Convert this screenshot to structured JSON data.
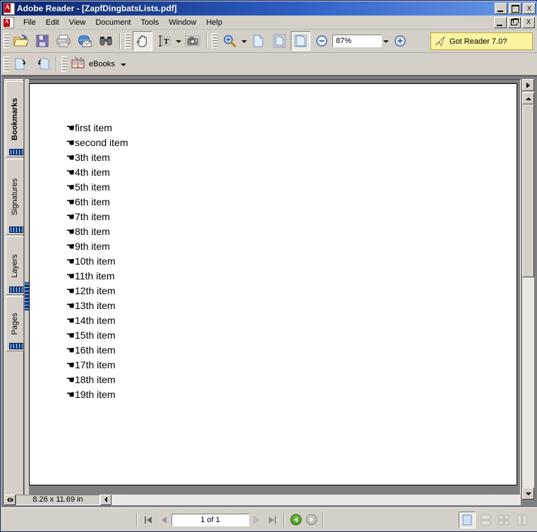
{
  "window": {
    "title": "Adobe Reader - [ZapfDingbatsLists.pdf]",
    "app_icon": "acrobat-icon",
    "controls": {
      "minimize": "_",
      "maximize": "□",
      "restore": "❐",
      "close": "X"
    }
  },
  "menu": {
    "icon": "acrobat-document-icon",
    "items": [
      {
        "label": "File"
      },
      {
        "label": "Edit"
      },
      {
        "label": "View"
      },
      {
        "label": "Document"
      },
      {
        "label": "Tools"
      },
      {
        "label": "Window"
      },
      {
        "label": "Help"
      }
    ]
  },
  "toolbar_main": {
    "groups": [
      {
        "buttons": [
          {
            "name": "open-file-button",
            "icon": "open-folder-icon"
          },
          {
            "name": "save-button",
            "icon": "floppy-disk-icon"
          },
          {
            "name": "print-button",
            "icon": "printer-icon"
          },
          {
            "name": "email-button",
            "icon": "globe-envelope-icon"
          },
          {
            "name": "search-button",
            "icon": "binoculars-icon"
          }
        ]
      },
      {
        "buttons": [
          {
            "name": "hand-tool-button",
            "icon": "hand-icon",
            "active": true
          },
          {
            "name": "select-text-tool-button",
            "icon": "text-select-icon",
            "has_dropdown": true
          },
          {
            "name": "snapshot-tool-button",
            "icon": "camera-icon"
          }
        ]
      },
      {
        "buttons": [
          {
            "name": "zoom-tool-button",
            "icon": "magnifier-plus-icon",
            "has_dropdown": true
          },
          {
            "name": "actual-size-button",
            "icon": "page-actual-size-icon"
          },
          {
            "name": "fit-page-button",
            "icon": "page-fit-icon"
          },
          {
            "name": "fit-width-button",
            "icon": "page-fit-width-icon"
          },
          {
            "name": "zoom-out-button",
            "icon": "circle-minus-icon"
          },
          {
            "name": "zoom-in-button",
            "icon": "circle-plus-icon"
          }
        ]
      }
    ],
    "zoom_value": "87%",
    "zoom_dropdown_icon": "chevron-down-icon"
  },
  "promo": {
    "label": "Got Reader 7.0?",
    "icon": "paper-plane-icon",
    "background": "#fbf3a0",
    "border": "#b9ad3a"
  },
  "toolbar_secondary": {
    "buttons": [
      {
        "name": "previous-view-button",
        "icon": "page-back-arrow-icon"
      },
      {
        "name": "next-view-button",
        "icon": "page-forward-arrow-icon"
      }
    ],
    "ebooks": {
      "label": "eBooks",
      "icon": "ebooks-icon",
      "dropdown_icon": "chevron-down-icon"
    }
  },
  "navigation_pane": {
    "tabs": [
      {
        "label": "Bookmarks",
        "selected": true
      },
      {
        "label": "Signatures",
        "selected": false
      },
      {
        "label": "Layers",
        "selected": false
      },
      {
        "label": "Pages",
        "selected": false
      }
    ]
  },
  "document": {
    "page_size": "8.26 x 11.69 in",
    "bullet_glyph": "☛",
    "items": [
      "first item",
      "second item",
      "3th item",
      "4th item",
      "5th item",
      "6th item",
      "7th item",
      "8th item",
      "9th item",
      "10th item",
      "11th item",
      "12th item",
      "13th item",
      "14th item",
      "15th item",
      "16th item",
      "17th item",
      "18th item",
      "19th item"
    ]
  },
  "status_bar": {
    "page_indicator": "1 of 1",
    "nav_buttons": [
      {
        "name": "first-page-button",
        "icon": "first-page-icon",
        "enabled": true
      },
      {
        "name": "previous-page-button",
        "icon": "previous-page-icon",
        "enabled": true
      },
      {
        "name": "next-page-button",
        "icon": "next-page-icon",
        "enabled": false
      },
      {
        "name": "last-page-button",
        "icon": "last-page-icon",
        "enabled": false
      }
    ],
    "history_buttons": [
      {
        "name": "go-back-button",
        "icon": "green-back-arrow-icon",
        "enabled": true
      },
      {
        "name": "go-forward-button",
        "icon": "gray-forward-arrow-icon",
        "enabled": false
      }
    ],
    "view_modes": [
      {
        "name": "single-page-view-button",
        "icon": "single-page-icon",
        "active": true
      },
      {
        "name": "continuous-view-button",
        "icon": "continuous-page-icon",
        "active": false
      },
      {
        "name": "continuous-facing-view-button",
        "icon": "continuous-facing-icon",
        "active": false
      },
      {
        "name": "facing-view-button",
        "icon": "facing-page-icon",
        "active": false
      }
    ]
  }
}
